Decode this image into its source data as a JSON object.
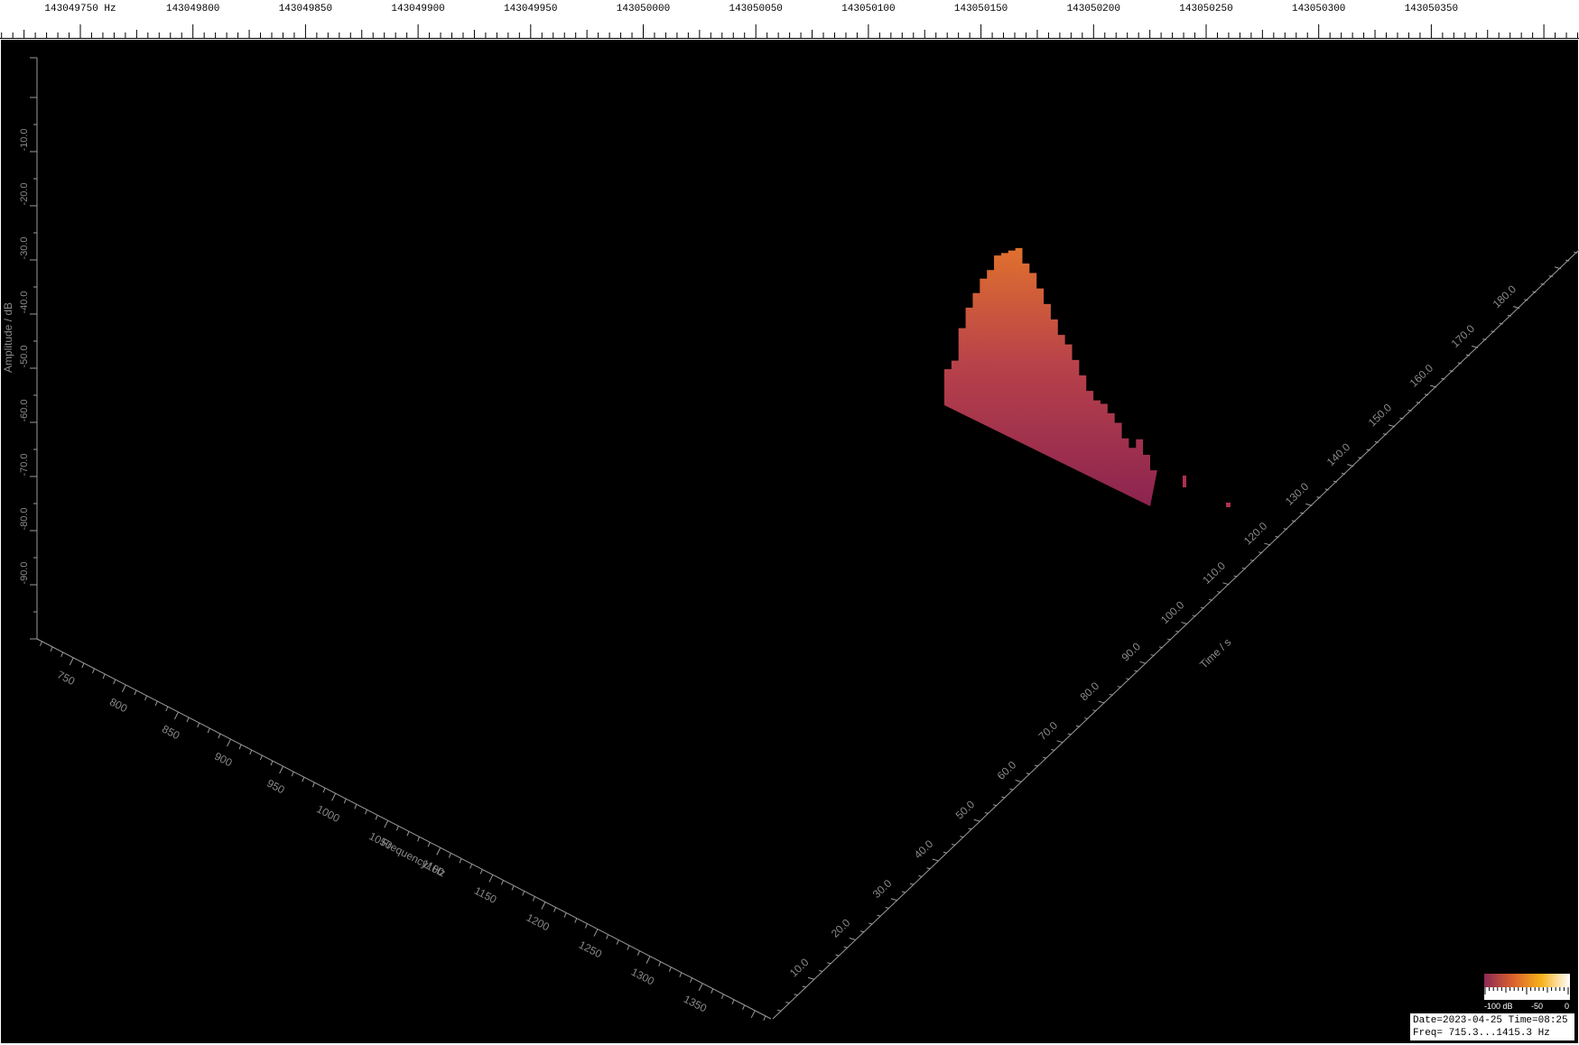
{
  "top_ruler": {
    "unit": "Hz",
    "labels": [
      "143049750",
      "143049800",
      "143049850",
      "143049900",
      "143049950",
      "143050000",
      "143050050",
      "143050100",
      "143050150",
      "143050200",
      "143050250",
      "143050300",
      "143050350"
    ]
  },
  "chart_data": {
    "type": "area",
    "projection": "3d-waterfall",
    "zlabel": "Amplitude / dB",
    "xlabel": "Frequency/ Hz",
    "ylabel": "Time / s",
    "z_ticks": [
      "-10.0",
      "-20.0",
      "-30.0",
      "-40.0",
      "-50.0",
      "-60.0",
      "-70.0",
      "-80.0",
      "-90.0"
    ],
    "x_ticks": [
      "750",
      "800",
      "850",
      "900",
      "950",
      "1000",
      "1050",
      "1100",
      "1150",
      "1200",
      "1250",
      "1300",
      "1350"
    ],
    "y_ticks": [
      "10.0",
      "20.0",
      "30.0",
      "40.0",
      "50.0",
      "60.0",
      "70.0",
      "80.0",
      "90.0",
      "100.0",
      "110.0",
      "120.0",
      "130.0",
      "140.0",
      "150.0",
      "160.0",
      "170.0",
      "180.0"
    ],
    "zlim": [
      -100,
      0
    ],
    "xlim": [
      715.3,
      1415.3
    ],
    "ylim": [
      0,
      180
    ],
    "series": [
      {
        "time": 92,
        "frequency": [
          1080,
          1090,
          1100,
          1110,
          1120,
          1130,
          1140,
          1150,
          1160,
          1170,
          1180,
          1190,
          1200,
          1210,
          1220,
          1230,
          1240,
          1250,
          1260,
          1270,
          1280,
          1290,
          1300,
          1310,
          1320,
          1330,
          1340,
          1350,
          1360,
          1370
        ],
        "amplitude": [
          -70,
          -68,
          -62,
          -58,
          -55,
          -52,
          -50,
          -47,
          -46,
          -45,
          -44,
          -46,
          -47,
          -49,
          -51,
          -53,
          -55,
          -56,
          -58,
          -60,
          -62,
          -63,
          -63,
          -64,
          -65,
          -67,
          -68,
          -66,
          -68,
          -70
        ]
      }
    ],
    "fragments": [
      {
        "time": 97,
        "frequency": 1395,
        "amplitude": -80
      },
      {
        "time": 104,
        "frequency": 1405,
        "amplitude": -88
      }
    ]
  },
  "colorbar": {
    "labels": [
      "-100 dB",
      "-50",
      "0"
    ],
    "colors": [
      "#8c2a55",
      "#d9602e",
      "#f7b21a",
      "#ffffff"
    ]
  },
  "info": {
    "line1": "Date=2023-04-25 Time=08:25",
    "line2": "Freq= 715.3...1415.3 Hz"
  }
}
